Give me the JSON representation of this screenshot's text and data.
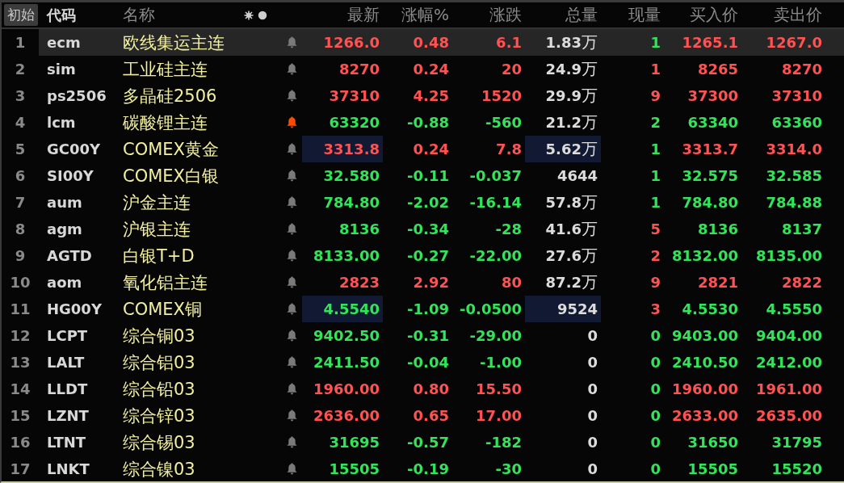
{
  "header": {
    "reset_button": "初始",
    "columns": [
      "代码",
      "名称",
      "最新",
      "涨幅%",
      "涨跌",
      "总量",
      "现量",
      "买入价",
      "卖出价"
    ]
  },
  "rows": [
    {
      "index": "1",
      "code": "ecm",
      "name": "欧线集运主连",
      "alert": false,
      "selected": true,
      "flash": false,
      "rising": true,
      "qty_rising": false,
      "last": "1266.0",
      "pct": "0.48",
      "change": "6.1",
      "volume": "1.83",
      "volume_unit": "万",
      "qty": "1",
      "bid": "1265.1",
      "ask": "1267.0"
    },
    {
      "index": "2",
      "code": "sim",
      "name": "工业硅主连",
      "alert": false,
      "selected": false,
      "flash": false,
      "rising": true,
      "qty_rising": true,
      "last": "8270",
      "pct": "0.24",
      "change": "20",
      "volume": "24.9",
      "volume_unit": "万",
      "qty": "1",
      "bid": "8265",
      "ask": "8270"
    },
    {
      "index": "3",
      "code": "ps2506",
      "name": "多晶硅2506",
      "alert": false,
      "selected": false,
      "flash": false,
      "rising": true,
      "qty_rising": true,
      "last": "37310",
      "pct": "4.25",
      "change": "1520",
      "volume": "29.9",
      "volume_unit": "万",
      "qty": "9",
      "bid": "37300",
      "ask": "37310"
    },
    {
      "index": "4",
      "code": "lcm",
      "name": "碳酸锂主连",
      "alert": true,
      "selected": false,
      "flash": false,
      "rising": false,
      "qty_rising": false,
      "last": "63320",
      "pct": "-0.88",
      "change": "-560",
      "volume": "21.2",
      "volume_unit": "万",
      "qty": "2",
      "bid": "63340",
      "ask": "63360"
    },
    {
      "index": "5",
      "code": "GC00Y",
      "name": "COMEX黄金",
      "alert": false,
      "selected": false,
      "flash": true,
      "rising": true,
      "qty_rising": false,
      "last": "3313.8",
      "pct": "0.24",
      "change": "7.8",
      "volume": "5.62",
      "volume_unit": "万",
      "qty": "1",
      "bid": "3313.7",
      "ask": "3314.0"
    },
    {
      "index": "6",
      "code": "SI00Y",
      "name": "COMEX白银",
      "alert": false,
      "selected": false,
      "flash": false,
      "rising": false,
      "qty_rising": false,
      "last": "32.580",
      "pct": "-0.11",
      "change": "-0.037",
      "volume": "4644",
      "qty": "1",
      "bid": "32.575",
      "ask": "32.585"
    },
    {
      "index": "7",
      "code": "aum",
      "name": "沪金主连",
      "alert": false,
      "selected": false,
      "flash": false,
      "rising": false,
      "qty_rising": false,
      "last": "784.80",
      "pct": "-2.02",
      "change": "-16.14",
      "volume": "57.8",
      "volume_unit": "万",
      "qty": "1",
      "bid": "784.80",
      "ask": "784.88"
    },
    {
      "index": "8",
      "code": "agm",
      "name": "沪银主连",
      "alert": false,
      "selected": false,
      "flash": false,
      "rising": false,
      "qty_rising": true,
      "last": "8136",
      "pct": "-0.34",
      "change": "-28",
      "volume": "41.6",
      "volume_unit": "万",
      "qty": "5",
      "bid": "8136",
      "ask": "8137"
    },
    {
      "index": "9",
      "code": "AGTD",
      "name": "白银T+D",
      "alert": false,
      "selected": false,
      "flash": false,
      "rising": false,
      "qty_rising": true,
      "last": "8133.00",
      "pct": "-0.27",
      "change": "-22.00",
      "volume": "27.6",
      "volume_unit": "万",
      "qty": "2",
      "bid": "8132.00",
      "ask": "8135.00"
    },
    {
      "index": "10",
      "code": "aom",
      "name": "氧化铝主连",
      "alert": false,
      "selected": false,
      "flash": false,
      "rising": true,
      "qty_rising": true,
      "last": "2823",
      "pct": "2.92",
      "change": "80",
      "volume": "87.2",
      "volume_unit": "万",
      "qty": "9",
      "bid": "2821",
      "ask": "2822"
    },
    {
      "index": "11",
      "code": "HG00Y",
      "name": "COMEX铜",
      "alert": false,
      "selected": false,
      "flash": true,
      "rising": false,
      "qty_rising": true,
      "last": "4.5540",
      "pct": "-1.09",
      "change": "-0.0500",
      "volume": "9524",
      "qty": "3",
      "bid": "4.5530",
      "ask": "4.5550"
    },
    {
      "index": "12",
      "code": "LCPT",
      "name": "综合铜03",
      "alert": false,
      "selected": false,
      "flash": false,
      "rising": false,
      "qty_rising": false,
      "last": "9402.50",
      "pct": "-0.31",
      "change": "-29.00",
      "volume": "0",
      "qty": "0",
      "bid": "9403.00",
      "ask": "9404.00"
    },
    {
      "index": "13",
      "code": "LALT",
      "name": "综合铝03",
      "alert": false,
      "selected": false,
      "flash": false,
      "rising": false,
      "qty_rising": false,
      "last": "2411.50",
      "pct": "-0.04",
      "change": "-1.00",
      "volume": "0",
      "qty": "0",
      "bid": "2410.50",
      "ask": "2412.00"
    },
    {
      "index": "14",
      "code": "LLDT",
      "name": "综合铅03",
      "alert": false,
      "selected": false,
      "flash": false,
      "rising": true,
      "qty_rising": false,
      "last": "1960.00",
      "pct": "0.80",
      "change": "15.50",
      "volume": "0",
      "qty": "0",
      "bid": "1960.00",
      "ask": "1961.00"
    },
    {
      "index": "15",
      "code": "LZNT",
      "name": "综合锌03",
      "alert": false,
      "selected": false,
      "flash": false,
      "rising": true,
      "qty_rising": false,
      "last": "2636.00",
      "pct": "0.65",
      "change": "17.00",
      "volume": "0",
      "qty": "0",
      "bid": "2633.00",
      "ask": "2635.00"
    },
    {
      "index": "16",
      "code": "LTNT",
      "name": "综合锡03",
      "alert": false,
      "selected": false,
      "flash": false,
      "rising": false,
      "qty_rising": false,
      "last": "31695",
      "pct": "-0.57",
      "change": "-182",
      "volume": "0",
      "qty": "0",
      "bid": "31650",
      "ask": "31795"
    },
    {
      "index": "17",
      "code": "LNKT",
      "name": "综合镍03",
      "alert": false,
      "selected": false,
      "flash": false,
      "rising": false,
      "qty_rising": false,
      "last": "15505",
      "pct": "-0.19",
      "change": "-30",
      "volume": "0",
      "qty": "0",
      "bid": "15505",
      "ask": "15520"
    }
  ]
}
